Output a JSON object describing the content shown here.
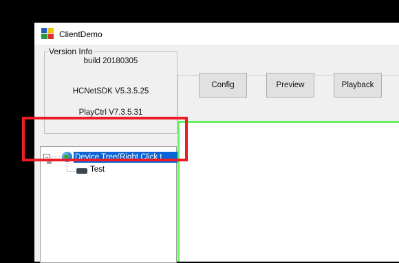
{
  "window": {
    "title": "ClientDemo",
    "app_icon": "clientdemo-app-icon"
  },
  "version_info": {
    "legend": "Version Info",
    "build": "build 20180305",
    "sdk": "HCNetSDK V5.3.5.25",
    "playctrl": "PlayCtrl V7.3.5.31"
  },
  "device_tree": {
    "root_label": "Device Tree(Right Click t",
    "root_icon": "globe-icon",
    "expander": "−",
    "children": [
      {
        "label": "Test",
        "icon": "dvr-device-icon"
      }
    ]
  },
  "toolbar": {
    "config_label": "Config",
    "preview_label": "Preview",
    "playback_label": "Playback"
  },
  "colors": {
    "annotation_box": "#ee1c25",
    "selection": "#0a64d6",
    "video_border": "#63f55f"
  }
}
